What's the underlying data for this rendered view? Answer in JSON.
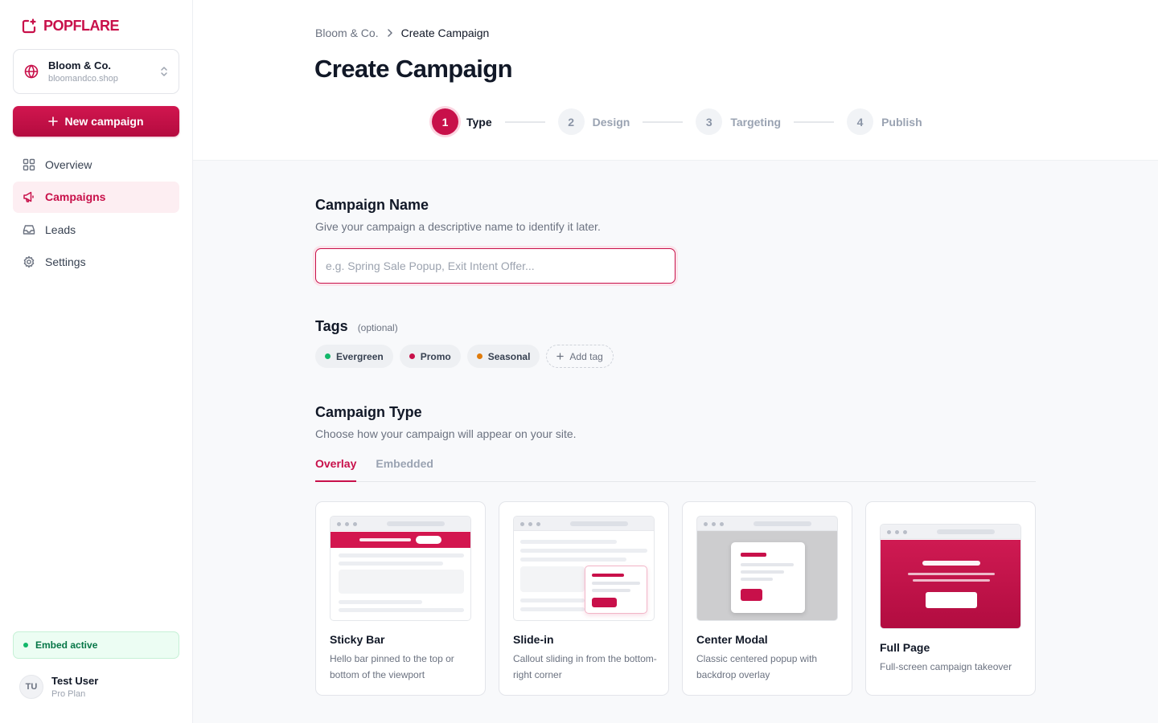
{
  "app": {
    "brand": "POPFLARE",
    "brand_color": "#c8104a"
  },
  "store": {
    "name": "Bloom & Co.",
    "domain": "bloomandco.shop"
  },
  "sidebar": {
    "new_campaign_label": "New campaign",
    "nav": [
      {
        "label": "Overview",
        "icon": "grid-icon",
        "active": false
      },
      {
        "label": "Campaigns",
        "icon": "megaphone-icon",
        "active": true
      },
      {
        "label": "Leads",
        "icon": "inbox-icon",
        "active": false
      },
      {
        "label": "Settings",
        "icon": "gear-icon",
        "active": false
      }
    ],
    "embed_status": "Embed active",
    "user": {
      "initials": "TU",
      "name": "Test User",
      "plan": "Pro Plan"
    }
  },
  "header": {
    "breadcrumb": {
      "parent": "Bloom & Co.",
      "current": "Create Campaign"
    },
    "title": "Create Campaign",
    "steps": [
      {
        "num": "1",
        "label": "Type",
        "active": true
      },
      {
        "num": "2",
        "label": "Design",
        "active": false
      },
      {
        "num": "3",
        "label": "Targeting",
        "active": false
      },
      {
        "num": "4",
        "label": "Publish",
        "active": false
      }
    ]
  },
  "campaign_name": {
    "title": "Campaign Name",
    "subtitle": "Give your campaign a descriptive name to identify it later.",
    "placeholder": "e.g. Spring Sale Popup, Exit Intent Offer...",
    "value": ""
  },
  "tags": {
    "title": "Tags",
    "optional_label": "(optional)",
    "items": [
      {
        "label": "Evergreen",
        "color": "#12b76a"
      },
      {
        "label": "Promo",
        "color": "#c8104a"
      },
      {
        "label": "Seasonal",
        "color": "#e07b0b"
      }
    ],
    "add_label": "Add tag"
  },
  "campaign_type": {
    "title": "Campaign Type",
    "subtitle": "Choose how your campaign will appear on your site.",
    "tabs": [
      {
        "label": "Overlay",
        "active": true
      },
      {
        "label": "Embedded",
        "active": false
      }
    ],
    "cards": [
      {
        "title": "Sticky Bar",
        "desc": "Hello bar pinned to the top or bottom of the viewport"
      },
      {
        "title": "Slide-in",
        "desc": "Callout sliding in from the bottom-right corner"
      },
      {
        "title": "Center Modal",
        "desc": "Classic centered popup with backdrop overlay"
      },
      {
        "title": "Full Page",
        "desc": "Full-screen campaign takeover"
      }
    ]
  }
}
